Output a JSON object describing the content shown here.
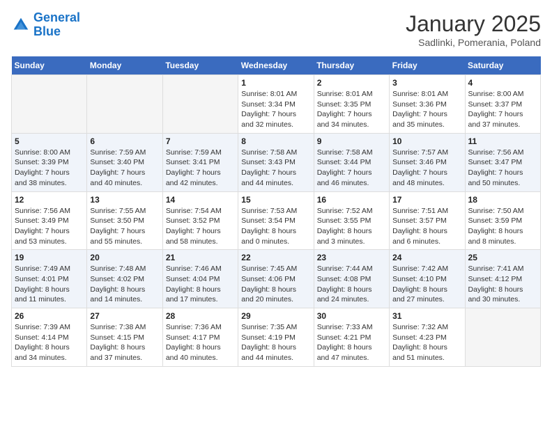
{
  "header": {
    "logo_line1": "General",
    "logo_line2": "Blue",
    "month_title": "January 2025",
    "subtitle": "Sadlinki, Pomerania, Poland"
  },
  "weekdays": [
    "Sunday",
    "Monday",
    "Tuesday",
    "Wednesday",
    "Thursday",
    "Friday",
    "Saturday"
  ],
  "weeks": [
    [
      {
        "day": "",
        "info": ""
      },
      {
        "day": "",
        "info": ""
      },
      {
        "day": "",
        "info": ""
      },
      {
        "day": "1",
        "info": "Sunrise: 8:01 AM\nSunset: 3:34 PM\nDaylight: 7 hours\nand 32 minutes."
      },
      {
        "day": "2",
        "info": "Sunrise: 8:01 AM\nSunset: 3:35 PM\nDaylight: 7 hours\nand 34 minutes."
      },
      {
        "day": "3",
        "info": "Sunrise: 8:01 AM\nSunset: 3:36 PM\nDaylight: 7 hours\nand 35 minutes."
      },
      {
        "day": "4",
        "info": "Sunrise: 8:00 AM\nSunset: 3:37 PM\nDaylight: 7 hours\nand 37 minutes."
      }
    ],
    [
      {
        "day": "5",
        "info": "Sunrise: 8:00 AM\nSunset: 3:39 PM\nDaylight: 7 hours\nand 38 minutes."
      },
      {
        "day": "6",
        "info": "Sunrise: 7:59 AM\nSunset: 3:40 PM\nDaylight: 7 hours\nand 40 minutes."
      },
      {
        "day": "7",
        "info": "Sunrise: 7:59 AM\nSunset: 3:41 PM\nDaylight: 7 hours\nand 42 minutes."
      },
      {
        "day": "8",
        "info": "Sunrise: 7:58 AM\nSunset: 3:43 PM\nDaylight: 7 hours\nand 44 minutes."
      },
      {
        "day": "9",
        "info": "Sunrise: 7:58 AM\nSunset: 3:44 PM\nDaylight: 7 hours\nand 46 minutes."
      },
      {
        "day": "10",
        "info": "Sunrise: 7:57 AM\nSunset: 3:46 PM\nDaylight: 7 hours\nand 48 minutes."
      },
      {
        "day": "11",
        "info": "Sunrise: 7:56 AM\nSunset: 3:47 PM\nDaylight: 7 hours\nand 50 minutes."
      }
    ],
    [
      {
        "day": "12",
        "info": "Sunrise: 7:56 AM\nSunset: 3:49 PM\nDaylight: 7 hours\nand 53 minutes."
      },
      {
        "day": "13",
        "info": "Sunrise: 7:55 AM\nSunset: 3:50 PM\nDaylight: 7 hours\nand 55 minutes."
      },
      {
        "day": "14",
        "info": "Sunrise: 7:54 AM\nSunset: 3:52 PM\nDaylight: 7 hours\nand 58 minutes."
      },
      {
        "day": "15",
        "info": "Sunrise: 7:53 AM\nSunset: 3:54 PM\nDaylight: 8 hours\nand 0 minutes."
      },
      {
        "day": "16",
        "info": "Sunrise: 7:52 AM\nSunset: 3:55 PM\nDaylight: 8 hours\nand 3 minutes."
      },
      {
        "day": "17",
        "info": "Sunrise: 7:51 AM\nSunset: 3:57 PM\nDaylight: 8 hours\nand 6 minutes."
      },
      {
        "day": "18",
        "info": "Sunrise: 7:50 AM\nSunset: 3:59 PM\nDaylight: 8 hours\nand 8 minutes."
      }
    ],
    [
      {
        "day": "19",
        "info": "Sunrise: 7:49 AM\nSunset: 4:01 PM\nDaylight: 8 hours\nand 11 minutes."
      },
      {
        "day": "20",
        "info": "Sunrise: 7:48 AM\nSunset: 4:02 PM\nDaylight: 8 hours\nand 14 minutes."
      },
      {
        "day": "21",
        "info": "Sunrise: 7:46 AM\nSunset: 4:04 PM\nDaylight: 8 hours\nand 17 minutes."
      },
      {
        "day": "22",
        "info": "Sunrise: 7:45 AM\nSunset: 4:06 PM\nDaylight: 8 hours\nand 20 minutes."
      },
      {
        "day": "23",
        "info": "Sunrise: 7:44 AM\nSunset: 4:08 PM\nDaylight: 8 hours\nand 24 minutes."
      },
      {
        "day": "24",
        "info": "Sunrise: 7:42 AM\nSunset: 4:10 PM\nDaylight: 8 hours\nand 27 minutes."
      },
      {
        "day": "25",
        "info": "Sunrise: 7:41 AM\nSunset: 4:12 PM\nDaylight: 8 hours\nand 30 minutes."
      }
    ],
    [
      {
        "day": "26",
        "info": "Sunrise: 7:39 AM\nSunset: 4:14 PM\nDaylight: 8 hours\nand 34 minutes."
      },
      {
        "day": "27",
        "info": "Sunrise: 7:38 AM\nSunset: 4:15 PM\nDaylight: 8 hours\nand 37 minutes."
      },
      {
        "day": "28",
        "info": "Sunrise: 7:36 AM\nSunset: 4:17 PM\nDaylight: 8 hours\nand 40 minutes."
      },
      {
        "day": "29",
        "info": "Sunrise: 7:35 AM\nSunset: 4:19 PM\nDaylight: 8 hours\nand 44 minutes."
      },
      {
        "day": "30",
        "info": "Sunrise: 7:33 AM\nSunset: 4:21 PM\nDaylight: 8 hours\nand 47 minutes."
      },
      {
        "day": "31",
        "info": "Sunrise: 7:32 AM\nSunset: 4:23 PM\nDaylight: 8 hours\nand 51 minutes."
      },
      {
        "day": "",
        "info": ""
      }
    ]
  ]
}
